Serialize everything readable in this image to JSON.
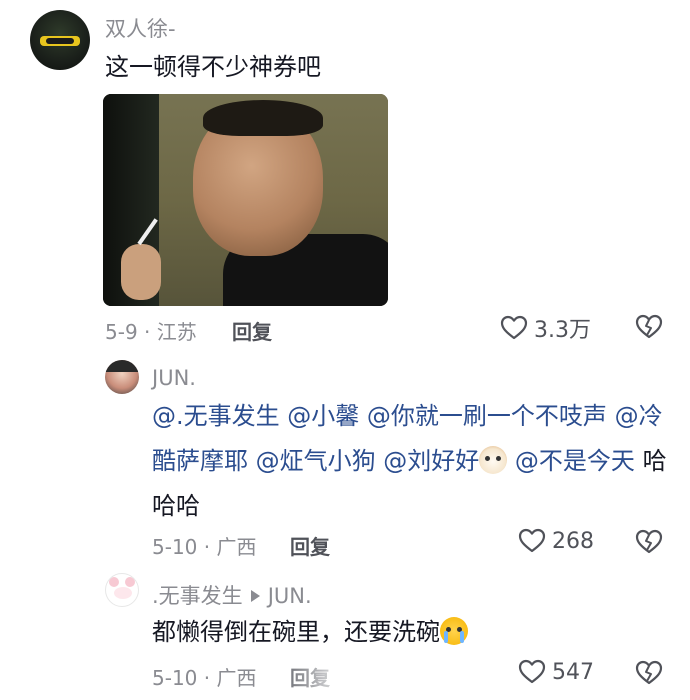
{
  "comments": [
    {
      "username": "双人徐-",
      "text": "这一顿得不少神券吧",
      "date_location": "5-9 · 江苏",
      "reply_label": "回复",
      "likes": "3.3万"
    },
    {
      "username": "JUN.",
      "mentions": [
        "@.无事发生",
        "@小馨",
        "@你就一刷一个不吱声",
        "@冷酷萨摩耶",
        "@炡气小狗",
        "@刘好好"
      ],
      "mention_last_a": "@不",
      "mention_last_b": "是今天",
      "text_tail": "哈哈哈",
      "date_location": "5-10 · 广西",
      "reply_label": "回复",
      "likes": "268"
    },
    {
      "username": ".无事发生",
      "reply_to": "JUN.",
      "text": "都懒得倒在碗里，还要洗碗",
      "date_location": "5-10 · 广西",
      "reply_label": "回复",
      "likes": "547"
    }
  ],
  "icons": {
    "like": "heart-outline-icon",
    "dislike": "broken-heart-icon",
    "emoji_dog": "dog-face-emoji",
    "emoji_cry": "loudly-crying-emoji"
  },
  "colors": {
    "mention": "#2b4d8f",
    "meta": "#8a8b91",
    "text": "#161823"
  }
}
